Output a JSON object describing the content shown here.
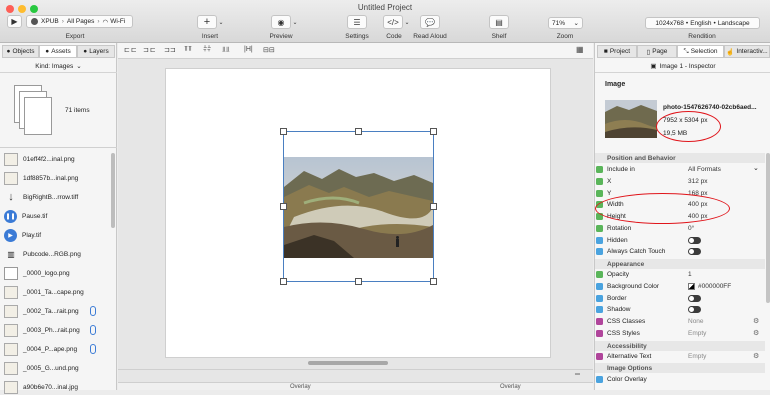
{
  "window": {
    "title": "Untitled Project"
  },
  "toolbar": {
    "export_breadcrumb": [
      "XPUB",
      "All Pages",
      "Wi-Fi"
    ],
    "export_label": "Export",
    "insert_label": "Insert",
    "preview_label": "Preview",
    "settings_label": "Settings",
    "code_label": "Code",
    "read_aloud_label": "Read Aloud",
    "shelf_label": "Shelf",
    "zoom_value": "71%",
    "zoom_label": "Zoom",
    "rendition_items": [
      "1024x768",
      "English",
      "Landscape"
    ],
    "rendition_label": "Rendition"
  },
  "left_panel": {
    "tabs": [
      "Objects",
      "Assets",
      "Layers"
    ],
    "active_tab": "Assets",
    "kind_filter": "Kind: Images",
    "items_count": "71 items",
    "assets": [
      {
        "name": "01eff4f2...inal.png",
        "icon": "image-thumb-icon",
        "clip": false
      },
      {
        "name": "1df8857b...inal.png",
        "icon": "image-thumb-icon",
        "clip": false
      },
      {
        "name": "BigRightB...rrow.tiff",
        "icon": "arrow-down-icon",
        "clip": false
      },
      {
        "name": "Pause.tif",
        "icon": "pause-icon",
        "clip": false
      },
      {
        "name": "Play.tif",
        "icon": "play-icon",
        "clip": false
      },
      {
        "name": "Pubcode...RGB.png",
        "icon": "barcode-icon",
        "clip": false
      },
      {
        "name": "_0000_logo.png",
        "icon": "logo-thumb-icon",
        "clip": false
      },
      {
        "name": "_0001_Ta...cape.png",
        "icon": "image-thumb-icon",
        "clip": false
      },
      {
        "name": "_0002_Ta...rait.png",
        "icon": "image-thumb-icon",
        "clip": true
      },
      {
        "name": "_0003_Ph...rait.png",
        "icon": "image-thumb-icon",
        "clip": true
      },
      {
        "name": "_0004_P...ape.png",
        "icon": "image-thumb-icon",
        "clip": true
      },
      {
        "name": "_0005_G...und.png",
        "icon": "image-thumb-icon",
        "clip": false
      },
      {
        "name": "a90b6e70...inal.jpg",
        "icon": "image-thumb-icon",
        "clip": false
      }
    ]
  },
  "center": {
    "bottom_left_label": "Overlay",
    "bottom_right_label": "Overlay"
  },
  "right_panel": {
    "tabs": [
      "Project",
      "Page",
      "Selection",
      "Interactiv..."
    ],
    "active_tab": "Selection",
    "inspector_title": "Image 1 - Inspector",
    "image_section_title": "Image",
    "file_name": "photo-1547626740-02cb6aed...",
    "dimensions": "7952 x 5304 px",
    "file_size": "19,5 MB",
    "position_header": "Position and Behavior",
    "props": [
      {
        "label": "Include in",
        "value": "All Formats",
        "type": "dropdown",
        "color": "#5ab55a"
      },
      {
        "label": "X",
        "value": "312 px",
        "type": "text",
        "color": "#5ab55a"
      },
      {
        "label": "Y",
        "value": "168 px",
        "type": "text",
        "color": "#5ab55a"
      },
      {
        "label": "Width",
        "value": "400 px",
        "type": "text",
        "color": "#5ab55a"
      },
      {
        "label": "Height",
        "value": "400 px",
        "type": "text",
        "color": "#5ab55a"
      },
      {
        "label": "Rotation",
        "value": "0°",
        "type": "text",
        "color": "#5ab55a"
      },
      {
        "label": "Hidden",
        "value": "",
        "type": "toggle",
        "color": "#4aa3df"
      },
      {
        "label": "Always Catch Touch",
        "value": "",
        "type": "toggle",
        "color": "#4aa3df"
      }
    ],
    "appearance_header": "Appearance",
    "appearance_props": [
      {
        "label": "Opacity",
        "value": "1",
        "type": "text",
        "color": "#5ab55a"
      },
      {
        "label": "Background Color",
        "value": "#000000FF",
        "type": "color",
        "color": "#4aa3df"
      },
      {
        "label": "Border",
        "value": "",
        "type": "toggle",
        "color": "#4aa3df"
      },
      {
        "label": "Shadow",
        "value": "",
        "type": "toggle",
        "color": "#4aa3df"
      },
      {
        "label": "CSS Classes",
        "value": "None",
        "type": "gear",
        "color": "#b0459b"
      },
      {
        "label": "CSS Styles",
        "value": "Empty",
        "type": "gear",
        "color": "#b0459b"
      }
    ],
    "accessibility_header": "Accessibility",
    "accessibility_props": [
      {
        "label": "Alternative Text",
        "value": "Empty",
        "type": "gear",
        "color": "#b0459b"
      }
    ],
    "image_options_header": "Image Options",
    "image_options_props": [
      {
        "label": "Color Overlay",
        "value": "",
        "type": "checkbox",
        "color": "#4aa3df"
      }
    ]
  },
  "colors": {
    "annotation_red": "#e0151b",
    "accent_blue": "#3b7bd6"
  }
}
